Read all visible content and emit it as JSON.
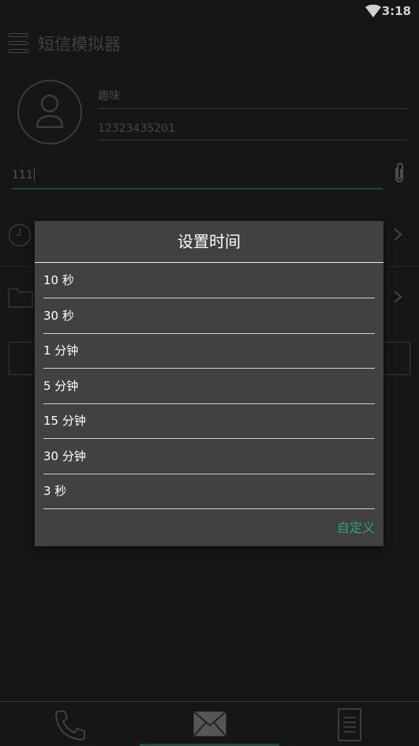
{
  "status": {
    "time": "3:18"
  },
  "app": {
    "title": "短信模拟器"
  },
  "contact": {
    "name": "趣味",
    "phone": "12323435201"
  },
  "message": {
    "text": "111"
  },
  "dialog": {
    "title": "设置时间",
    "options": [
      "10 秒",
      "30 秒",
      "1 分钟",
      "5 分钟",
      "15 分钟",
      "30 分钟",
      "3 秒"
    ],
    "custom_label": "自定义"
  },
  "colors": {
    "accent": "#2aa57a",
    "accent_dark": "#1f5a44"
  },
  "bottom_nav": {
    "items": [
      "phone-icon",
      "envelope-icon",
      "document-icon"
    ],
    "active": "envelope-icon"
  }
}
